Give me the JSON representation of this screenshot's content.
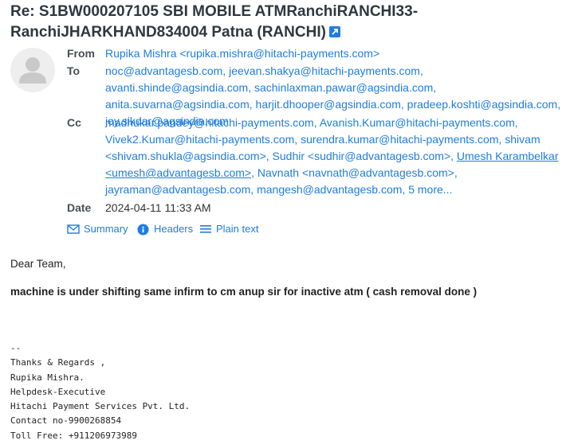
{
  "subject": "Re: S1BW000207105 SBI MOBILE ATMRanchiRANCHI33-RanchiJHARKHAND834004 Patna (RANCHI)",
  "icons": {
    "open_link": "external-link-icon",
    "avatar": "user-avatar-icon",
    "summary": "envelope-icon",
    "headers": "info-icon",
    "plain_text": "lines-icon"
  },
  "header": {
    "from_label": "From",
    "from_value": "Rupika Mishra <rupika.mishra@hitachi-payments.com>",
    "to_label": "To",
    "to": [
      "noc@advantagesb.com,",
      "jeevan.shakya@hitachi-payments.com,",
      "avanti.shinde@agsindia.com,",
      "sachinlaxman.pawar@agsindia.com,",
      "anita.suvarna@agsindia.com,",
      "harjit.dhooper@agsindia.com,",
      "pradeep.koshti@agsindia.com,",
      "joy.sikdar@agsindia.com"
    ],
    "cc_label": "Cc",
    "cc": [
      "madhukar.pandey@hitachi-payments.com,",
      "Avanish.Kumar@hitachi-payments.com,",
      "Vivek2.Kumar@hitachi-payments.com,",
      "surendra.kumar@hitachi-payments.com,",
      "shivam <shivam.shukla@agsindia.com>,",
      "Sudhir <sudhir@advantagesb.com>,",
      "Umesh Karambelkar <umesh@advantagesb.com>",
      ",",
      "Navnath <navnath@advantagesb.com>,",
      "jayraman@advantagesb.com,",
      "mangesh@advantagesb.com,",
      "5 more..."
    ],
    "date_label": "Date",
    "date_value": "2024-04-11 11:33 AM"
  },
  "views": {
    "summary": "Summary",
    "headers": "Headers",
    "plain_text": "Plain text"
  },
  "body": {
    "greeting": "Dear Team,",
    "message": "machine is under shifting same infirm to cm anup sir for inactive atm ( cash removal done )",
    "signature": [
      "--",
      "Thanks & Regards ,",
      "Rupika Mishra.",
      "Helpdesk-Executive",
      "Hitachi Payment Services Pvt. Ltd.",
      "Contact no-9900268854",
      "Toll Free: +911206973989"
    ]
  },
  "colors": {
    "link": "#1f7de0",
    "title": "#2f3740",
    "avatar_bg": "#eeeeee",
    "avatar_fg": "#c9c9c9"
  }
}
